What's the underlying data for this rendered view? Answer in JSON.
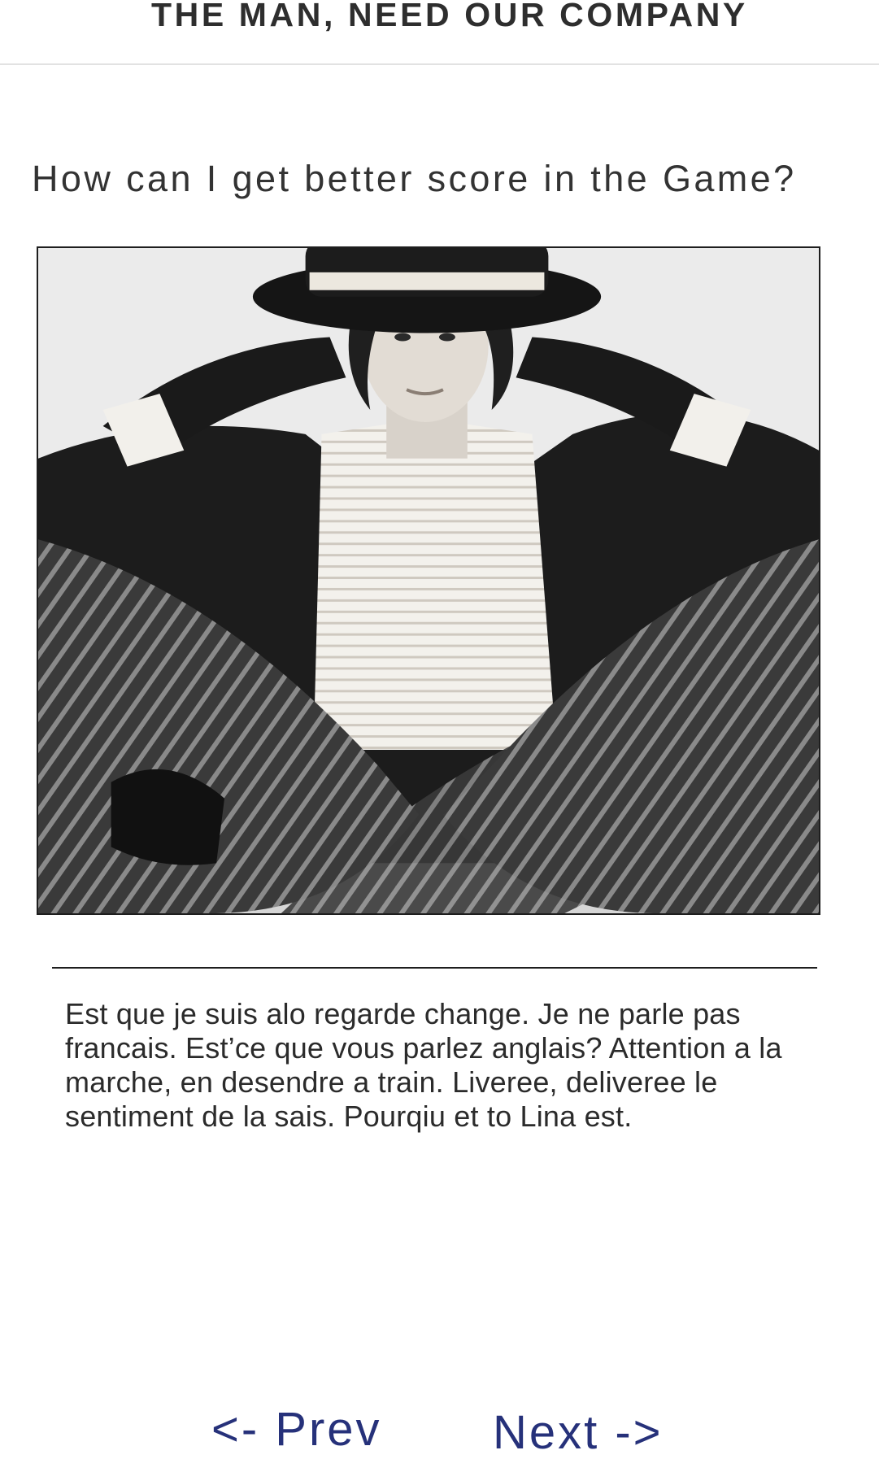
{
  "header": {
    "title": "THE MAN, NEED OUR COMPANY"
  },
  "main": {
    "question": "How can I get better score in the Game?",
    "body_text": "Est que je suis alo regarde change. Je ne parle pas francais. Est’ce que vous parlez anglais? Attention a la marche, en desendre a train. Liveree, deliveree le sentiment de la sais. Pourqiu et to Lina est."
  },
  "navigation": {
    "prev_label": "<- Prev",
    "next_label": "Next ->"
  },
  "colors": {
    "link": "#26317a",
    "text": "#2b2b2b",
    "divider": "#1e1e1e"
  }
}
